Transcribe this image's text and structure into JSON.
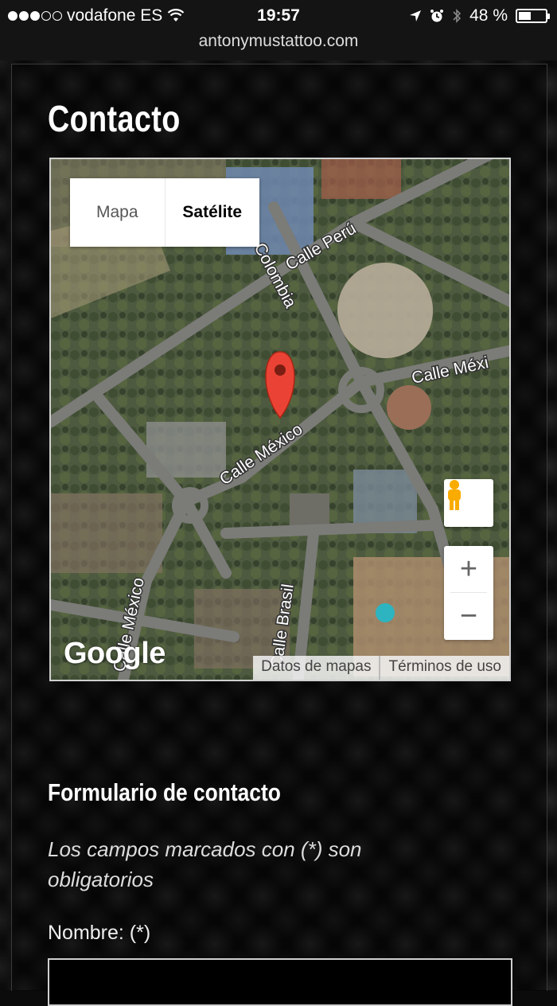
{
  "status_bar": {
    "carrier": "vodafone ES",
    "time": "19:57",
    "battery": "48 %",
    "battery_level": 0.48
  },
  "url": "antonymustattoo.com",
  "page": {
    "title": "Contacto"
  },
  "map": {
    "type_buttons": {
      "map": "Mapa",
      "satellite": "Satélite"
    },
    "selected_type": "Satélite",
    "street_labels": [
      "Calle Perú",
      "Colombia",
      "Calle Méxi",
      "Calle México",
      "Calle México",
      "Calle Brasil"
    ],
    "zoom_in": "+",
    "zoom_out": "−",
    "logo": "Google",
    "attribution": {
      "map_data": "Datos de mapas",
      "terms": "Términos de uso"
    }
  },
  "form": {
    "title": "Formulario de contacto",
    "note": "Los campos marcados con (*) son obligatorios",
    "name_label": "Nombre: (*)",
    "name_value": ""
  },
  "colors": {
    "background": "#0a0a0a",
    "pin": "#ea4335",
    "map_border": "#d0d0d0"
  }
}
